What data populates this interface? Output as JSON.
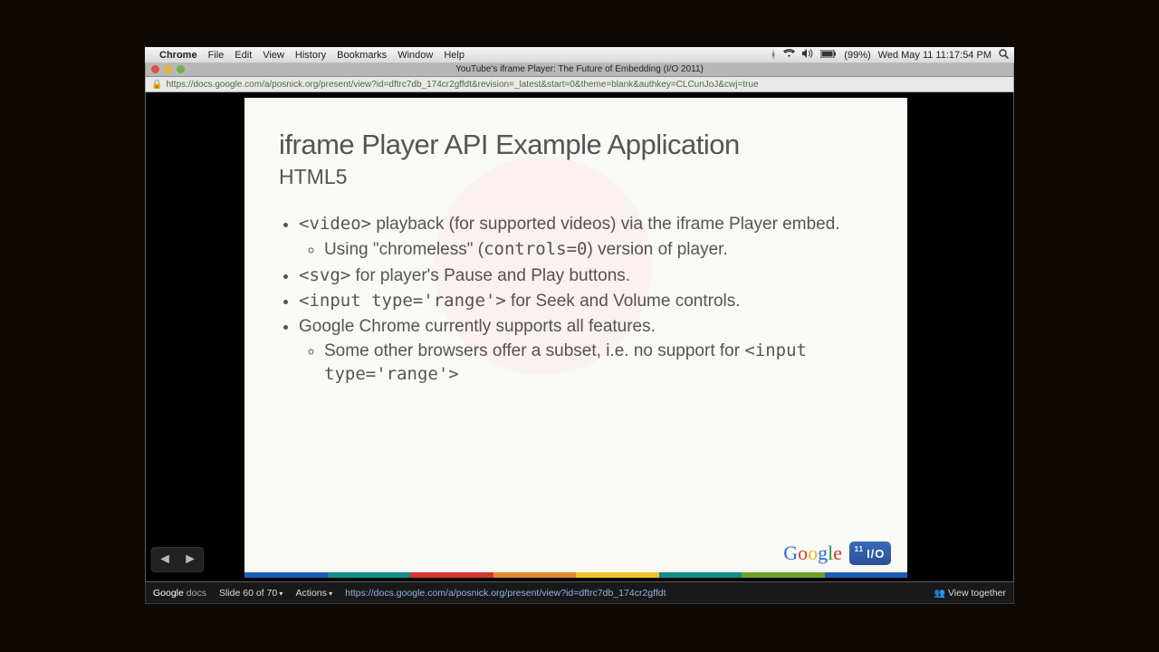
{
  "menubar": {
    "app": "Chrome",
    "items": [
      "File",
      "Edit",
      "View",
      "History",
      "Bookmarks",
      "Window",
      "Help"
    ],
    "battery": "(99%)",
    "clock": "Wed May 11  11:17:54 PM"
  },
  "tab": {
    "title": "YouTube's iframe Player: The Future of Embedding (I/O 2011)"
  },
  "url": "https://docs.google.com/a/posnick.org/present/view?id=dftrc7db_174cr2gffdt&revision=_latest&start=0&theme=blank&authkey=CLCunJoJ&cwj=true",
  "slide": {
    "title": "iframe Player API Example Application",
    "subtitle": "HTML5",
    "b1_code": "<video>",
    "b1_rest": " playback (for supported videos) via the iframe Player embed.",
    "b1_sub_pre": "Using \"chromeless\" (",
    "b1_sub_code": "controls=0",
    "b1_sub_post": ") version of player.",
    "b2_code": "<svg>",
    "b2_rest": " for player's Pause and Play buttons.",
    "b3_code": "<input type='range'>",
    "b3_rest": " for Seek and Volume controls.",
    "b4": "Google Chrome currently supports all features.",
    "b4_sub_pre": "Some other browsers offer a subset, i.e. no support for ",
    "b4_sub_code": "<input type='range'>",
    "io_tag": "I/O",
    "io_year": "11"
  },
  "rainbow": [
    "#1b5fb5",
    "#0f8f8a",
    "#d6362c",
    "#e6892b",
    "#f2c22b",
    "#0f8f8a",
    "#6aa426",
    "#1b5fb5"
  ],
  "footer": {
    "brand_a": "Google",
    "brand_b": " docs",
    "slide_counter": "Slide 60 of 70",
    "actions": "Actions",
    "status_url": "https://docs.google.com/a/posnick.org/present/view?id=dftrc7db_174cr2gffdt",
    "view_together": "View together"
  }
}
